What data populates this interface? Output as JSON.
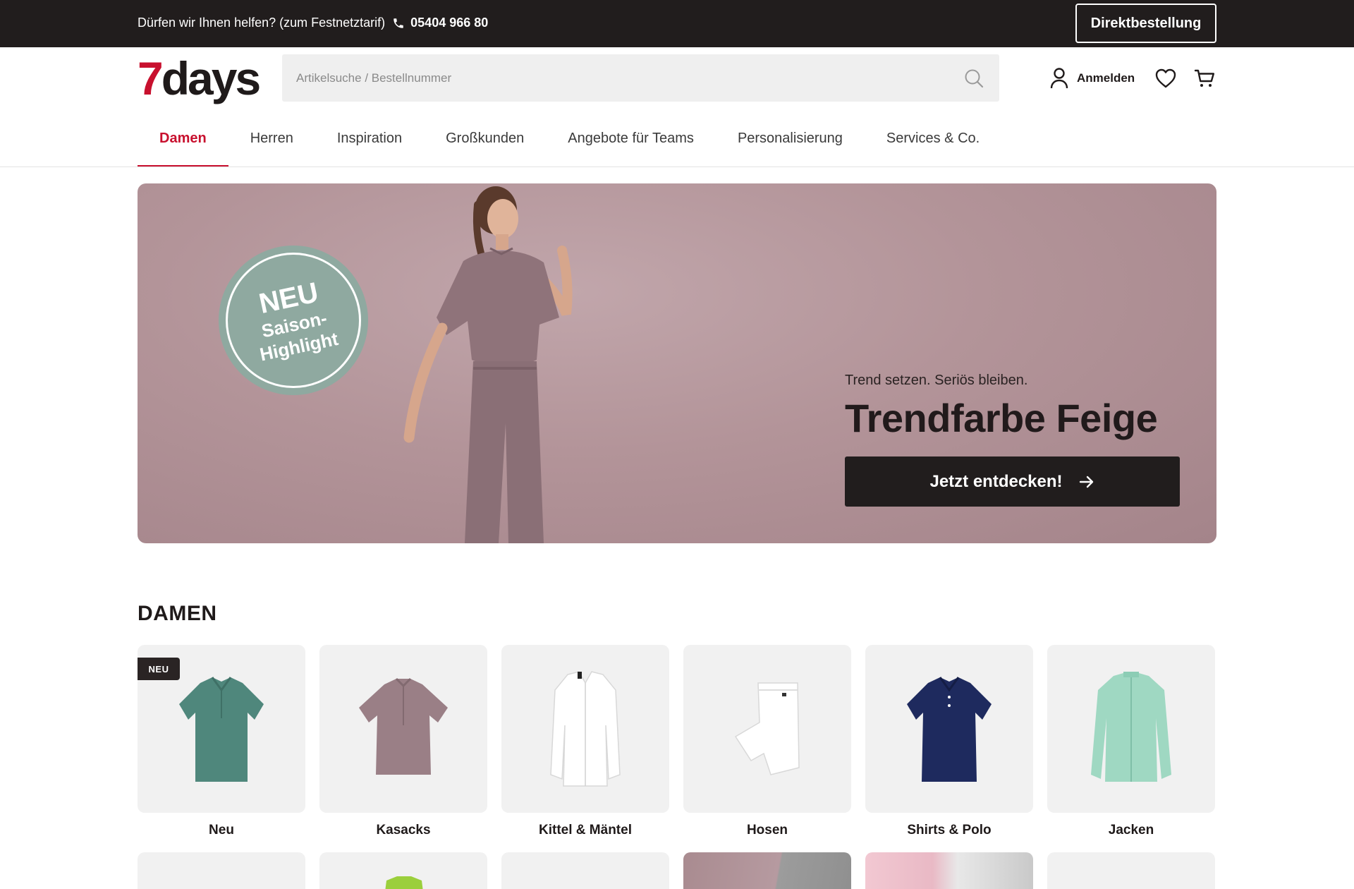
{
  "topbar": {
    "help_text": "Dürfen wir Ihnen helfen? (zum Festnetztarif)",
    "phone": "05404 966 80",
    "direct_order": "Direktbestellung"
  },
  "header": {
    "logo_seven": "7",
    "logo_days": "days",
    "search_placeholder": "Artikelsuche / Bestellnummer",
    "login_label": "Anmelden"
  },
  "nav": {
    "items": [
      {
        "label": "Damen",
        "active": true
      },
      {
        "label": "Herren"
      },
      {
        "label": "Inspiration"
      },
      {
        "label": "Großkunden"
      },
      {
        "label": "Angebote für Teams"
      },
      {
        "label": "Personalisierung"
      },
      {
        "label": "Services & Co."
      }
    ]
  },
  "hero": {
    "badge_line1": "NEU",
    "badge_line2": "Saison-",
    "badge_line3": "Highlight",
    "subtitle": "Trend setzen. Seriös bleiben.",
    "title": "Trendfarbe Feige",
    "cta": "Jetzt entdecken!"
  },
  "section": {
    "title": "DAMEN",
    "tiles": [
      {
        "label": "Neu",
        "tag": "NEU",
        "color": "#4f877c"
      },
      {
        "label": "Kasacks",
        "color": "#9a7f86"
      },
      {
        "label": "Kittel & Mäntel",
        "color": "#ffffff"
      },
      {
        "label": "Hosen",
        "color": "#ffffff"
      },
      {
        "label": "Shirts & Polo",
        "color": "#1e2a5e"
      },
      {
        "label": "Jacken",
        "color": "#9fd8c2"
      }
    ]
  },
  "colors": {
    "accent": "#c8102e",
    "topbar": "#211d1d",
    "hero_bg": "#b39499",
    "badge": "#8fa9a0"
  }
}
